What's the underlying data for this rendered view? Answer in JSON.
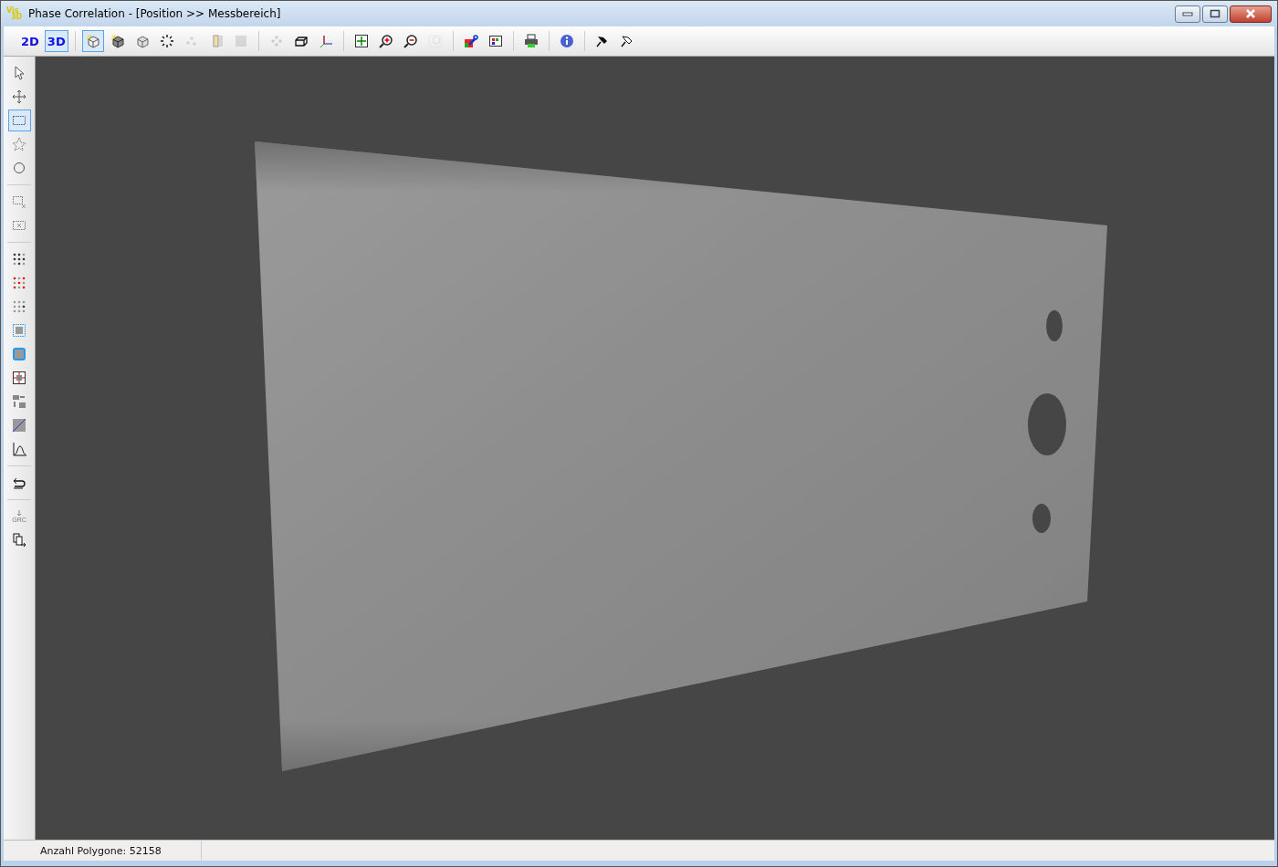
{
  "window": {
    "logo": [
      "Vis",
      "3D"
    ],
    "title": "Phase Correlation - [Position >> Messbereich]"
  },
  "toolbar": {
    "view_modes": [
      {
        "label": "2D",
        "selected": false
      },
      {
        "label": "3D",
        "selected": true
      }
    ],
    "tools": [
      {
        "selected": true,
        "disabled": false
      },
      {
        "selected": false,
        "disabled": false
      },
      {
        "selected": false,
        "disabled": false
      },
      {
        "selected": false,
        "disabled": false
      },
      {
        "selected": false,
        "disabled": true
      },
      {
        "selected": false,
        "disabled": false
      },
      {
        "selected": false,
        "disabled": true
      },
      {
        "selected": false,
        "disabled": true
      },
      {
        "selected": false,
        "disabled": false
      },
      {
        "selected": false,
        "disabled": false
      },
      {
        "selected": false,
        "disabled": false
      },
      {
        "selected": false,
        "disabled": false
      },
      {
        "selected": false,
        "disabled": false
      },
      {
        "selected": false,
        "disabled": true
      },
      {
        "selected": false,
        "disabled": false
      },
      {
        "selected": false,
        "disabled": false
      },
      {
        "selected": false,
        "disabled": false
      },
      {
        "selected": false,
        "disabled": false
      },
      {
        "selected": false,
        "disabled": false
      },
      {
        "selected": false,
        "disabled": false
      }
    ]
  },
  "side_toolbar": {
    "tools": [
      {
        "selected": false
      },
      {
        "selected": false
      },
      {
        "selected": true
      },
      {
        "selected": false
      },
      {
        "selected": false
      },
      {
        "selected": false
      },
      {
        "selected": false
      },
      {
        "selected": false
      },
      {
        "selected": false
      },
      {
        "selected": false
      },
      {
        "selected": false
      },
      {
        "selected": false
      },
      {
        "selected": false
      },
      {
        "selected": false
      },
      {
        "selected": false
      },
      {
        "selected": false
      },
      {
        "selected": false
      },
      {
        "selected": false,
        "label": "GRC"
      },
      {
        "selected": false
      }
    ]
  },
  "status_bar": {
    "text": "Anzahl Polygone: 52158"
  }
}
